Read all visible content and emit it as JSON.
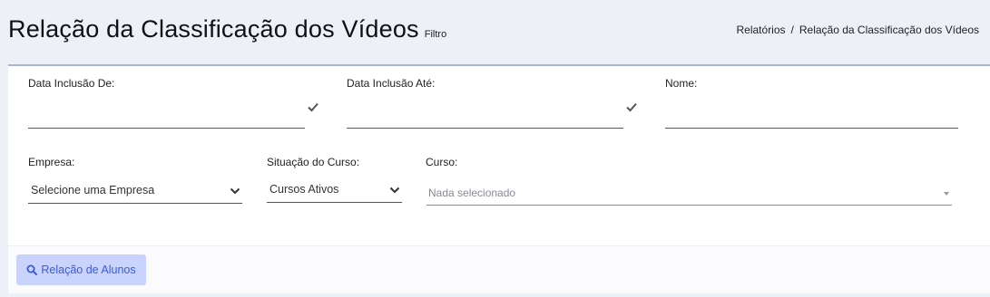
{
  "header": {
    "title": "Relação da Classificação dos Vídeos",
    "subtitle": "Filtro",
    "breadcrumb": [
      "Relatórios",
      "Relação da Classificação dos Vídeos"
    ],
    "breadcrumb_separator": "/"
  },
  "filters": {
    "data_inclusao_de": {
      "label": "Data Inclusão De:",
      "value": ""
    },
    "data_inclusao_ate": {
      "label": "Data Inclusão Até:",
      "value": ""
    },
    "nome": {
      "label": "Nome:",
      "value": ""
    },
    "empresa": {
      "label": "Empresa:",
      "selected": "Selecione uma Empresa"
    },
    "situacao_curso": {
      "label": "Situação do Curso:",
      "selected": "Cursos Ativos"
    },
    "curso": {
      "label": "Curso:",
      "placeholder": "Nada selecionado"
    }
  },
  "footer": {
    "submit_label": "Relação de Alunos",
    "submit_icon": "search-icon"
  },
  "colors": {
    "background": "#eef0f8",
    "card": "#ffffff",
    "card_top_border": "#a7b3d8",
    "button_bg": "#c9d3fb",
    "button_text": "#3b5bd6"
  }
}
